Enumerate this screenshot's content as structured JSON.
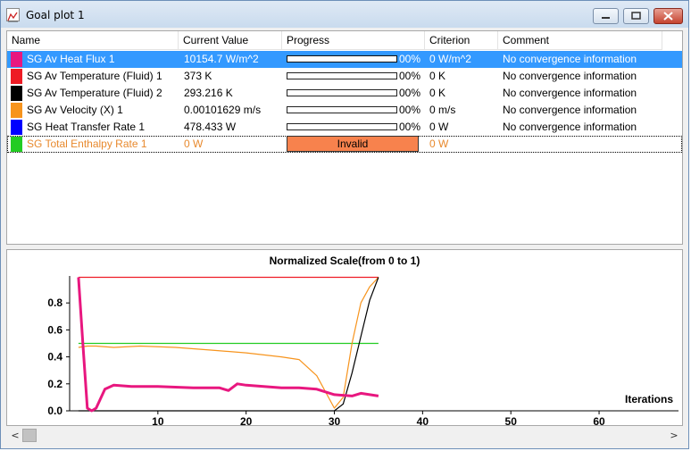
{
  "window": {
    "title": "Goal plot 1"
  },
  "table": {
    "headers": {
      "name": "Name",
      "value": "Current Value",
      "progress": "Progress",
      "criterion": "Criterion",
      "comment": "Comment"
    },
    "rows": [
      {
        "name": "SG Av Heat Flux 1",
        "swatch": "#e8177f",
        "value": "10154.7 W/m^2",
        "progress_pct": 0,
        "progress_label": "00%",
        "criterion": "0 W/m^2",
        "comment": "No convergence information"
      },
      {
        "name": "SG Av Temperature (Fluid) 1",
        "swatch": "#ee1c25",
        "value": "373 K",
        "progress_pct": 0,
        "progress_label": "00%",
        "criterion": "0 K",
        "comment": "No convergence information"
      },
      {
        "name": "SG Av Temperature (Fluid) 2",
        "swatch": "#000000",
        "value": "293.216 K",
        "progress_pct": 0,
        "progress_label": "00%",
        "criterion": "0 K",
        "comment": "No convergence information"
      },
      {
        "name": "SG Av Velocity (X) 1",
        "swatch": "#f7941d",
        "value": "0.00101629 m/s",
        "progress_pct": 0,
        "progress_label": "00%",
        "criterion": "0 m/s",
        "comment": "No convergence information"
      },
      {
        "name": "SG Heat Transfer Rate 1",
        "swatch": "#0000ff",
        "value": "478.433 W",
        "progress_pct": 0,
        "progress_label": "00%",
        "criterion": "0 W",
        "comment": "No convergence information"
      },
      {
        "name": "SG Total Enthalpy Rate 1",
        "swatch": "#22cc22",
        "value": "0 W",
        "progress_label": "Invalid",
        "criterion": "0 W",
        "comment": ""
      }
    ]
  },
  "chart_data": {
    "type": "line",
    "title": "Normalized Scale(from 0 to 1)",
    "xlabel": "Iterations",
    "ylabel": "",
    "xlim": [
      0,
      69
    ],
    "ylim": [
      0,
      1
    ],
    "xticks": [
      10,
      20,
      30,
      40,
      50,
      60
    ],
    "yticks": [
      0.0,
      0.2,
      0.4,
      0.6,
      0.8
    ],
    "ytick_labels": [
      "0.0",
      "0.2",
      "0.4",
      "0.6",
      "0.8"
    ],
    "series": [
      {
        "color": "#ee1c25",
        "x": [
          1,
          35
        ],
        "y": [
          0.99,
          0.99
        ]
      },
      {
        "color": "#22cc22",
        "x": [
          1,
          35
        ],
        "y": [
          0.5,
          0.5
        ]
      },
      {
        "color": "#f7941d",
        "x": [
          1,
          2,
          3,
          5,
          8,
          12,
          16,
          20,
          24,
          26,
          28,
          30,
          31,
          32,
          33,
          34,
          35
        ],
        "y": [
          0.47,
          0.48,
          0.48,
          0.47,
          0.48,
          0.47,
          0.45,
          0.43,
          0.4,
          0.38,
          0.26,
          0.02,
          0.1,
          0.5,
          0.8,
          0.92,
          0.99
        ]
      },
      {
        "color": "#000000",
        "x": [
          1,
          10,
          20,
          29,
          30,
          31,
          32,
          33,
          34,
          35
        ],
        "y": [
          0.0,
          0.0,
          0.0,
          0.0,
          0.0,
          0.05,
          0.28,
          0.55,
          0.82,
          0.99
        ]
      },
      {
        "color": "#e8177f",
        "x": [
          1,
          1.5,
          2,
          2.5,
          3,
          4,
          5,
          7,
          10,
          14,
          17,
          18,
          19,
          20,
          22,
          24,
          26,
          28,
          30,
          32,
          33,
          34,
          35
        ],
        "y": [
          0.99,
          0.5,
          0.02,
          0.0,
          0.02,
          0.16,
          0.19,
          0.18,
          0.18,
          0.17,
          0.17,
          0.15,
          0.2,
          0.19,
          0.18,
          0.17,
          0.17,
          0.16,
          0.12,
          0.11,
          0.13,
          0.12,
          0.11
        ]
      }
    ]
  },
  "scrollbar": {
    "left_arrow": "<",
    "right_arrow": ">"
  }
}
